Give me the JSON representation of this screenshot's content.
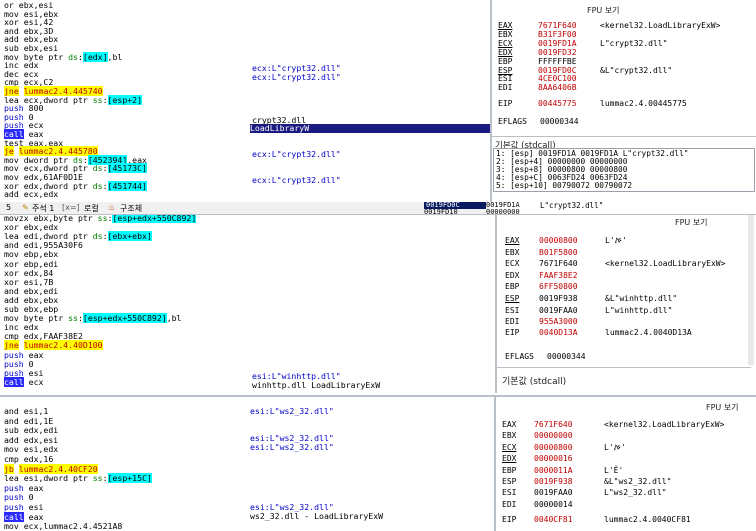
{
  "panel1": {
    "code": [
      {
        "t": "or ebx,esi"
      },
      {
        "t": "mov esi,ebx"
      },
      {
        "t": "xor esi,42"
      },
      {
        "t": "and ebx,3D"
      },
      {
        "t": "add ebx,ebx"
      },
      {
        "t": "sub ebx,esi"
      },
      {
        "t": "mov byte ptr ds:[edx],bl"
      },
      {
        "t": "inc edx"
      },
      {
        "t": "dec ecx"
      },
      {
        "t": "cmp ecx,C2"
      },
      {
        "t": "jne lummac2.4.445740"
      },
      {
        "t": "lea ecx,dword ptr ss:[esp+2]"
      },
      {
        "t": "push 800"
      },
      {
        "t": "push 0"
      },
      {
        "t": "push ecx"
      },
      {
        "t": "call eax"
      },
      {
        "t": "test eax,eax"
      },
      {
        "t": "je lummac2.4.445780"
      },
      {
        "t": "mov dword ptr ds:[452394],eax"
      },
      {
        "t": "mov ecx,dword ptr ds:[45173C]"
      },
      {
        "t": "mov edx,61AF0D1E"
      },
      {
        "t": "xor edx,dword ptr ds:[451744]"
      },
      {
        "t": "add ecx,edx"
      }
    ],
    "comments": [
      "ecx:L\"crypt32.dll\"",
      "ecx:L\"crypt32.dll\"",
      "crypt32.dll",
      "LoadLibraryW",
      "ecx:L\"crypt32.dll\"",
      "ecx:L\"crypt32.dll\""
    ],
    "fpu_title": "FPU 보기",
    "regs": [
      {
        "n": "EAX",
        "v": "7671F640",
        "c": "<kernel32.LoadLibraryExW>",
        "u": true,
        "red": true
      },
      {
        "n": "EBX",
        "v": "B31F3F00",
        "c": "",
        "u": false,
        "red": true
      },
      {
        "n": "ECX",
        "v": "0019FD1A",
        "c": "L\"crypt32.dll\"",
        "u": true,
        "red": true
      },
      {
        "n": "EDX",
        "v": "0019FD32",
        "c": "",
        "u": true,
        "red": true
      },
      {
        "n": "EBP",
        "v": "FFFFFFBE",
        "c": "",
        "u": false,
        "red": false
      },
      {
        "n": "ESP",
        "v": "0019FD0C",
        "c": "&L\"crypt32.dll\"",
        "u": true,
        "red": true
      },
      {
        "n": "ESI",
        "v": "4CE0C100",
        "c": "",
        "u": false,
        "red": true
      },
      {
        "n": "EDI",
        "v": "8AA6406B",
        "c": "",
        "u": false,
        "red": true
      }
    ],
    "eip": {
      "n": "EIP",
      "v": "00445775",
      "c": "lummac2.4.00445775"
    },
    "eflags": {
      "n": "EFLAGS",
      "v": "00000344"
    },
    "callconv": "기본값 (stdcall)",
    "stack": [
      "1: [esp] 0019FD1A 0019FD1A L\"crypt32.dll\"",
      "2: [esp+4] 00000000 00000000",
      "3: [esp+8] 00000800 00000800",
      "4: [esp+C] 0063FD24 0063FD24",
      "5: [esp+10] 00790072 00790072"
    ],
    "bottom_addr": [
      "0019FD0C",
      "0019FD10"
    ],
    "bottom_val": [
      "0019FD1A",
      "00000000"
    ],
    "bottom_comment": "L\"crypt32.dll\""
  },
  "tabs": {
    "num": "5",
    "items": [
      "주석 1",
      "로컬",
      "구조체"
    ],
    "icons": [
      "notes-icon",
      "locals-icon",
      "struct-icon"
    ]
  },
  "panel2": {
    "code": [
      {
        "t": "movzx ebx,byte ptr ss:[esp+edx+550C892]"
      },
      {
        "t": "xor ebx,edx"
      },
      {
        "t": "lea edi,dword ptr ds:[ebx+ebx]"
      },
      {
        "t": "and edi,955A30F6"
      },
      {
        "t": "mov ebp,ebx"
      },
      {
        "t": "xor ebp,edi"
      },
      {
        "t": "xor edx,84"
      },
      {
        "t": "xor esi,7B"
      },
      {
        "t": "and ebx,edi"
      },
      {
        "t": "add ebx,ebx"
      },
      {
        "t": "sub ebx,ebp"
      },
      {
        "t": "mov byte ptr ss:[esp+edx+550C892],bl"
      },
      {
        "t": "inc edx"
      },
      {
        "t": "cmp edx,FAAF38E2"
      },
      {
        "t": "jne lummac2.4.40D100"
      },
      {
        "t": "push eax"
      },
      {
        "t": "push 0"
      },
      {
        "t": "push esi"
      },
      {
        "t": "call ecx"
      }
    ],
    "comments": [
      "esi:L\"winhttp.dll\"",
      "winhttp.dll LoadLibraryExW"
    ],
    "fpu_title": "FPU 보기",
    "regs": [
      {
        "n": "EAX",
        "v": "00000800",
        "c": "L'ࠀ'",
        "u": true,
        "red": true
      },
      {
        "n": "EBX",
        "v": "B01F5800",
        "c": "",
        "u": false,
        "red": true
      },
      {
        "n": "ECX",
        "v": "7671F640",
        "c": "<kernel32.LoadLibraryExW>",
        "u": false,
        "red": false
      },
      {
        "n": "EDX",
        "v": "FAAF38E2",
        "c": "",
        "u": false,
        "red": true
      },
      {
        "n": "EBP",
        "v": "6FF50800",
        "c": "",
        "u": false,
        "red": true
      },
      {
        "n": "ESP",
        "v": "0019F938",
        "c": "&L\"winhttp.dll\"",
        "u": true,
        "red": false
      },
      {
        "n": "ESI",
        "v": "0019FAA0",
        "c": "L\"winhttp.dll\"",
        "u": false,
        "red": false
      },
      {
        "n": "EDI",
        "v": "955A3000",
        "c": "",
        "u": false,
        "red": true
      }
    ],
    "eip": {
      "n": "EIP",
      "v": "0040D13A",
      "c": "lummac2.4.0040D13A"
    },
    "eflags": {
      "n": "EFLAGS",
      "v": "00000344"
    },
    "callconv": "기본값 (stdcall)"
  },
  "panel3": {
    "code": [
      {
        "t": "and esi,1"
      },
      {
        "t": "and edi,1E"
      },
      {
        "t": "sub edx,edi"
      },
      {
        "t": "add edx,esi"
      },
      {
        "t": "mov esi,edx"
      },
      {
        "t": "cmp edx,16"
      },
      {
        "t": "jb lummac2.4.40CF20"
      },
      {
        "t": "lea esi,dword ptr ss:[esp+15C]"
      },
      {
        "t": "push eax"
      },
      {
        "t": "push 0"
      },
      {
        "t": "push esi"
      },
      {
        "t": "call eax"
      },
      {
        "t": "mov ecx,lummac2.4.4521A8"
      }
    ],
    "comments": [
      "esi:L\"ws2_32.dll\"",
      "esi:L\"ws2_32.dll\"",
      "esi:L\"ws2_32.dll\"",
      "esi:L\"ws2_32.dll\"",
      "ws2_32.dll - LoadLibraryExW"
    ],
    "fpu_title": "FPU 보기",
    "regs": [
      {
        "n": "EAX",
        "v": "7671F640",
        "c": "<kernel32.LoadLibraryExW>",
        "u": false,
        "red": true
      },
      {
        "n": "EBX",
        "v": "00000000",
        "c": "",
        "u": false,
        "red": true
      },
      {
        "n": "ECX",
        "v": "00000800",
        "c": "L'ࠀ'",
        "u": true,
        "red": true
      },
      {
        "n": "EDX",
        "v": "00000016",
        "c": "",
        "u": true,
        "red": true
      },
      {
        "n": "EBP",
        "v": "0000011A",
        "c": "L'Ě'",
        "u": false,
        "red": true
      },
      {
        "n": "ESP",
        "v": "0019F938",
        "c": "&L\"ws2_32.dll\"",
        "u": false,
        "red": true
      },
      {
        "n": "ESI",
        "v": "0019FAA0",
        "c": "L\"ws2_32.dll\"",
        "u": false,
        "red": false
      },
      {
        "n": "EDI",
        "v": "00000014",
        "c": "",
        "u": false,
        "red": false
      }
    ],
    "eip": {
      "n": "EIP",
      "v": "0040CF81",
      "c": "lummac2.4.0040CF81"
    }
  }
}
